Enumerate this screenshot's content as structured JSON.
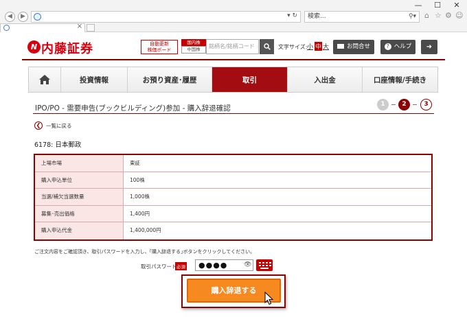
{
  "browser": {
    "search_placeholder": "検索...",
    "tab_close": "×",
    "window_controls": [
      "—",
      "☐",
      "✕"
    ]
  },
  "header": {
    "logo_mark": "N",
    "logo_text": "内藤証券",
    "auto_refresh_line1": "自動更新",
    "auto_refresh_line2": "株価ボード",
    "market_domestic": "国内株",
    "market_china": "中国株",
    "symbol_placeholder": "銘柄名/銘柄コード",
    "font_size_label": "文字サイズ:",
    "font_small": "小",
    "font_medium": "中",
    "font_large": "大",
    "contact_label": "お問合せ",
    "help_label": "ヘルプ"
  },
  "nav": {
    "items": [
      {
        "label": ""
      },
      {
        "label": "投資情報"
      },
      {
        "label": "お預り資産･履歴"
      },
      {
        "label": "取引"
      },
      {
        "label": "入出金"
      },
      {
        "label": "口座情報/手続き"
      }
    ],
    "active_index": 3
  },
  "page": {
    "title": "IPO/PO - 需要申告(ブックビルディング)参加 - 購入辞退確認",
    "steps": [
      "1",
      "2",
      "3"
    ],
    "current_step": 2,
    "back_label": "一覧に戻る",
    "stock": "6178: 日本郵政"
  },
  "table": [
    {
      "label": "上場市場",
      "value": "東証"
    },
    {
      "label": "購入申込単位",
      "value": "100株"
    },
    {
      "label": "当選/補欠当選数量",
      "value": "1,000株"
    },
    {
      "label": "募集･売出価格",
      "value": "1,400円"
    },
    {
      "label": "購入申込代金",
      "value": "1,400,000円"
    }
  ],
  "form": {
    "note": "ご注文内容をご確認頂き、取引パスワードを入力し、｢購入辞退する｣ボタンをクリックしてください。",
    "password_label": "取引パスワード",
    "required_badge": "必須",
    "password_value": "●●●●",
    "submit_label": "購入辞退する"
  },
  "colors": {
    "brand_red": "#d7000f",
    "nav_active": "#a30d11",
    "submit_orange": "#f6891f"
  }
}
